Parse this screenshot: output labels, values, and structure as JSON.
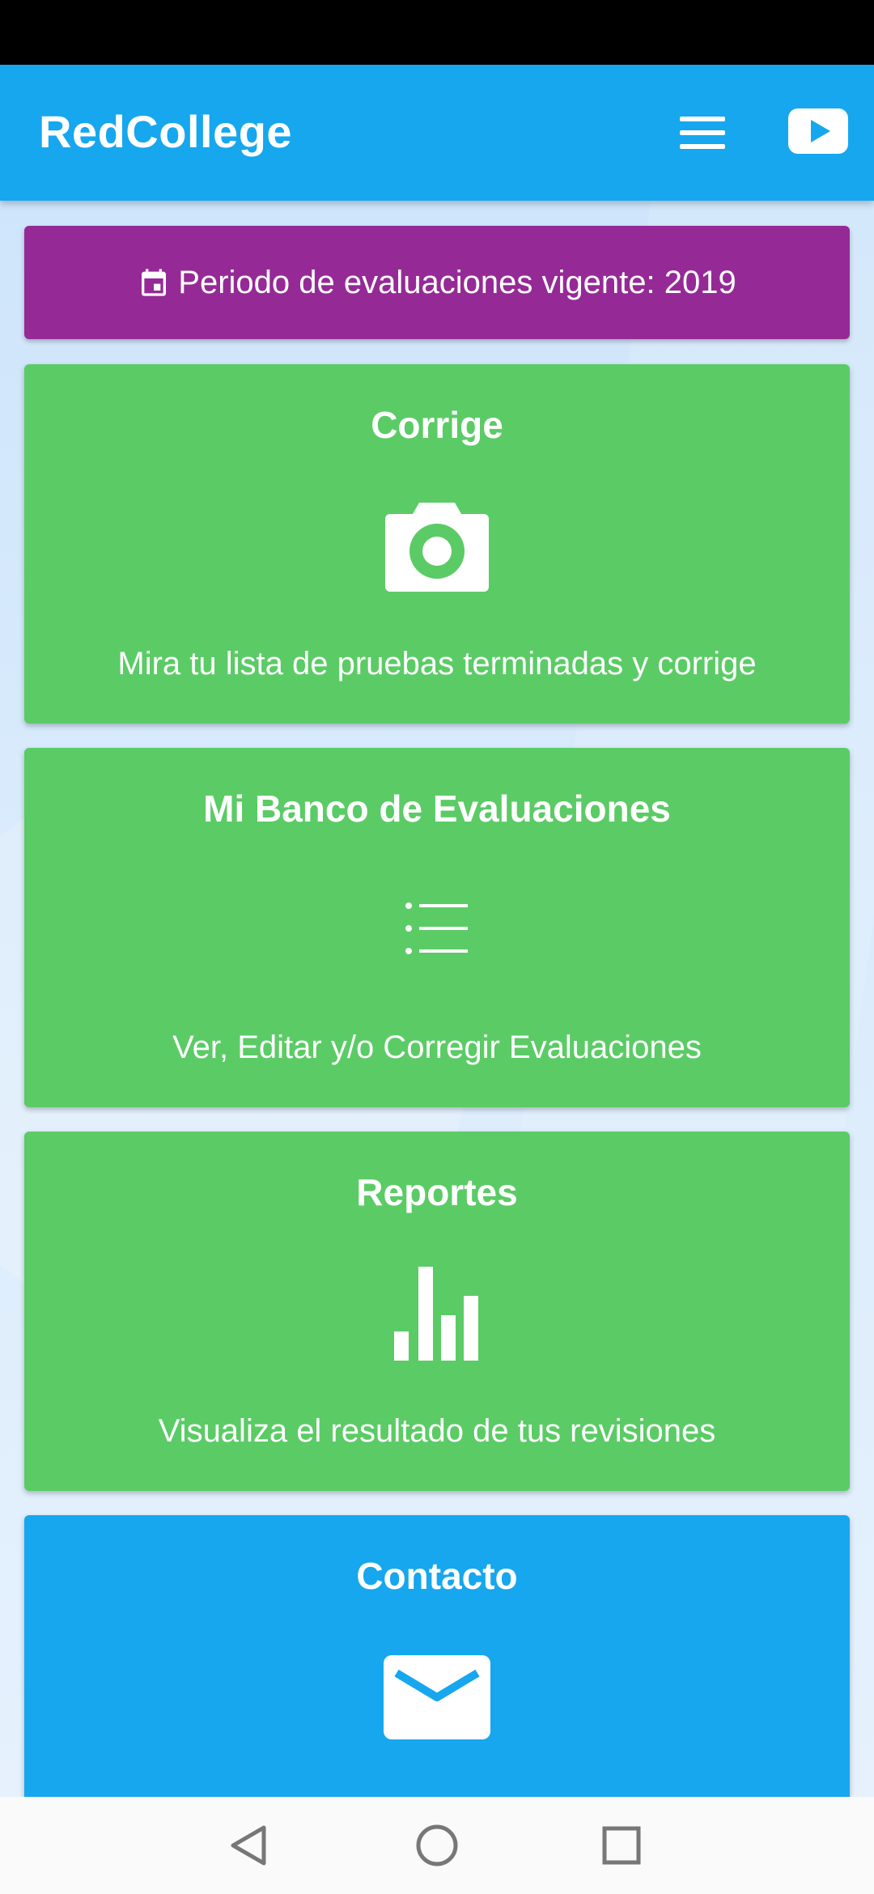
{
  "app": {
    "title": "RedCollege"
  },
  "header": {
    "menu_icon": "hamburger-menu-icon",
    "video_icon": "youtube-play-icon"
  },
  "banner": {
    "icon": "calendar-icon",
    "text": "Periodo de evaluaciones vigente: 2019"
  },
  "cards": [
    {
      "title": "Corrige",
      "icon": "camera-icon",
      "description": "Mira tu lista de pruebas terminadas y corrige",
      "color": "#5bcb66"
    },
    {
      "title": "Mi Banco de Evaluaciones",
      "icon": "list-icon",
      "description": "Ver, Editar y/o Corregir Evaluaciones",
      "color": "#5bcb66"
    },
    {
      "title": "Reportes",
      "icon": "bar-chart-icon",
      "description": "Visualiza el resultado de tus revisiones",
      "color": "#5bcb66"
    },
    {
      "title": "Contacto",
      "icon": "mail-icon",
      "color": "#16a7ee"
    }
  ],
  "colors": {
    "appbar": "#16a7ee",
    "banner": "#952a96",
    "card_green": "#5bcb66",
    "card_blue": "#16a7ee"
  },
  "navigation": {
    "back_icon": "back-triangle-icon",
    "home_icon": "home-circle-icon",
    "recents_icon": "recents-square-icon"
  }
}
